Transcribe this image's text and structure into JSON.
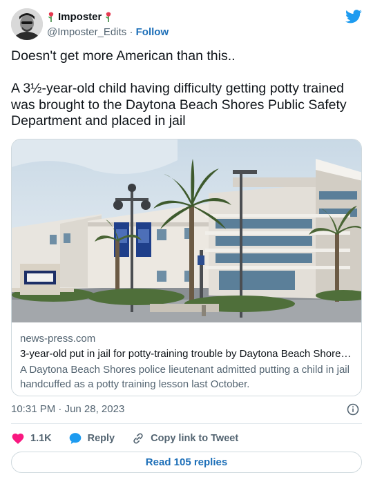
{
  "header": {
    "display_name": "Imposter",
    "handle": "@Imposter_Edits",
    "separator": "·",
    "follow_label": "Follow",
    "brand_color": "#1d9bf0"
  },
  "tweet": {
    "line1": "Doesn't get more American than this..",
    "line2": "A 3½-year-old child having difficulty getting potty trained was brought to the Daytona Beach Shores Public Safety Department and placed in jail"
  },
  "link_card": {
    "domain": "news-press.com",
    "title": "3-year-old put in jail for potty-training trouble by Daytona Beach Shores…",
    "description": "A Daytona Beach Shores police lieutenant admitted putting a child in jail handcuffed as a potty training lesson last October."
  },
  "meta": {
    "time": "10:31 PM",
    "date": "Jun 28, 2023",
    "separator": "·"
  },
  "actions": {
    "likes": "1.1K",
    "reply": "Reply",
    "copy_link": "Copy link to Tweet",
    "like_color": "#f91880",
    "reply_color": "#1d9bf0"
  },
  "footer": {
    "read_replies": "Read 105 replies"
  },
  "icons": [
    "rose-icon",
    "twitter-bird-icon",
    "info-icon",
    "heart-icon",
    "reply-bubble-icon",
    "link-icon"
  ]
}
